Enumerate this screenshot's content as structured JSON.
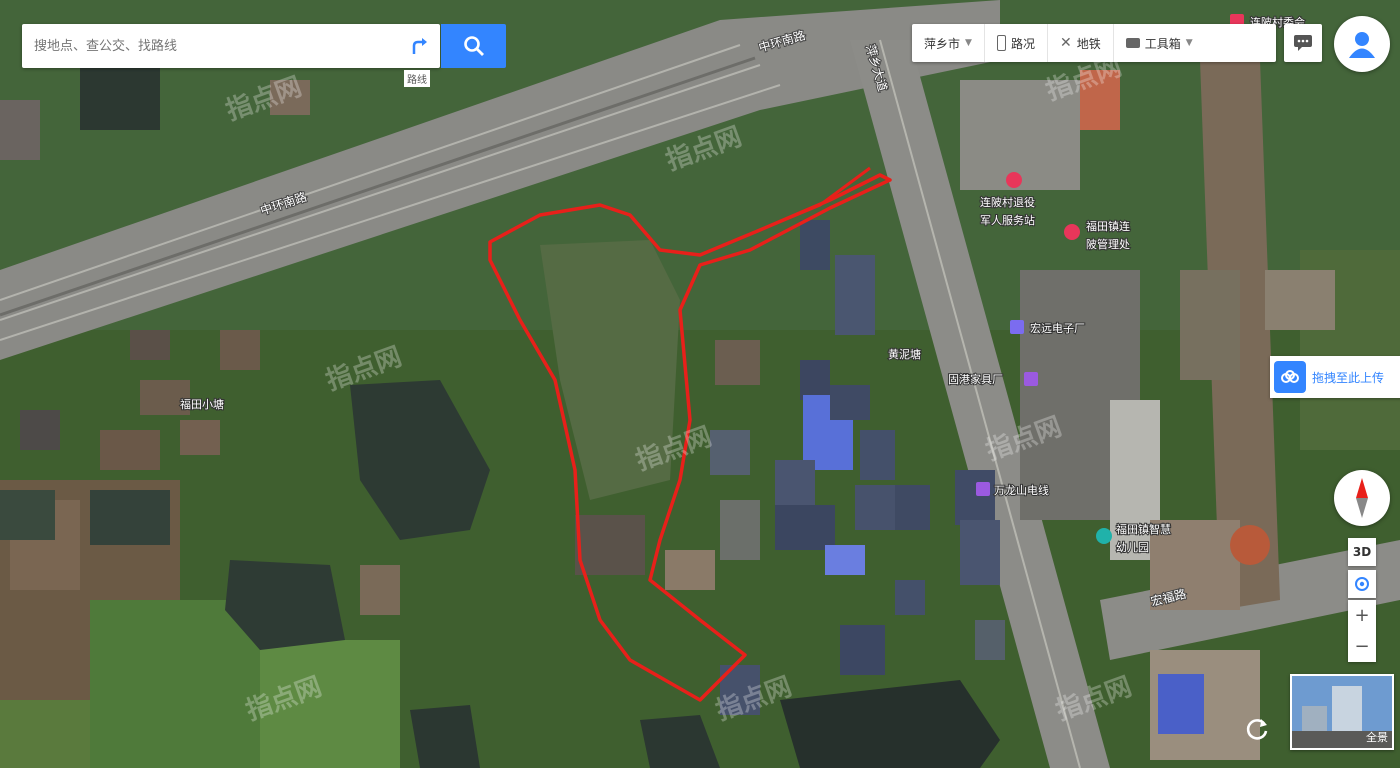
{
  "search": {
    "placeholder": "搜地点、查公交、找路线",
    "route_label": "路线"
  },
  "toolbar": {
    "city": "萍乡市",
    "traffic": "路况",
    "subway": "地铁",
    "tools": "工具箱"
  },
  "map_labels": {
    "roads": [
      "中环南路",
      "中环南路",
      "萍乡大道",
      "宏福路"
    ],
    "places": [
      "福田小塘",
      "黄泥塘"
    ],
    "pois": [
      "连陂村退役",
      "军人服务站",
      "福田镇连",
      "陂管理处",
      "宏远电子厂",
      "固港家具厂",
      "万龙山电线",
      "福田镇智慧",
      "幼儿园",
      "连陂村委会"
    ]
  },
  "watermark": "指点网",
  "drag_box": {
    "label": "拖拽至此上传"
  },
  "controls": {
    "three_d": "3D",
    "zoom_in": "+",
    "zoom_out": "−",
    "panorama": "全景"
  },
  "colors": {
    "accent": "#3385ff",
    "boundary": "#e8201a"
  }
}
